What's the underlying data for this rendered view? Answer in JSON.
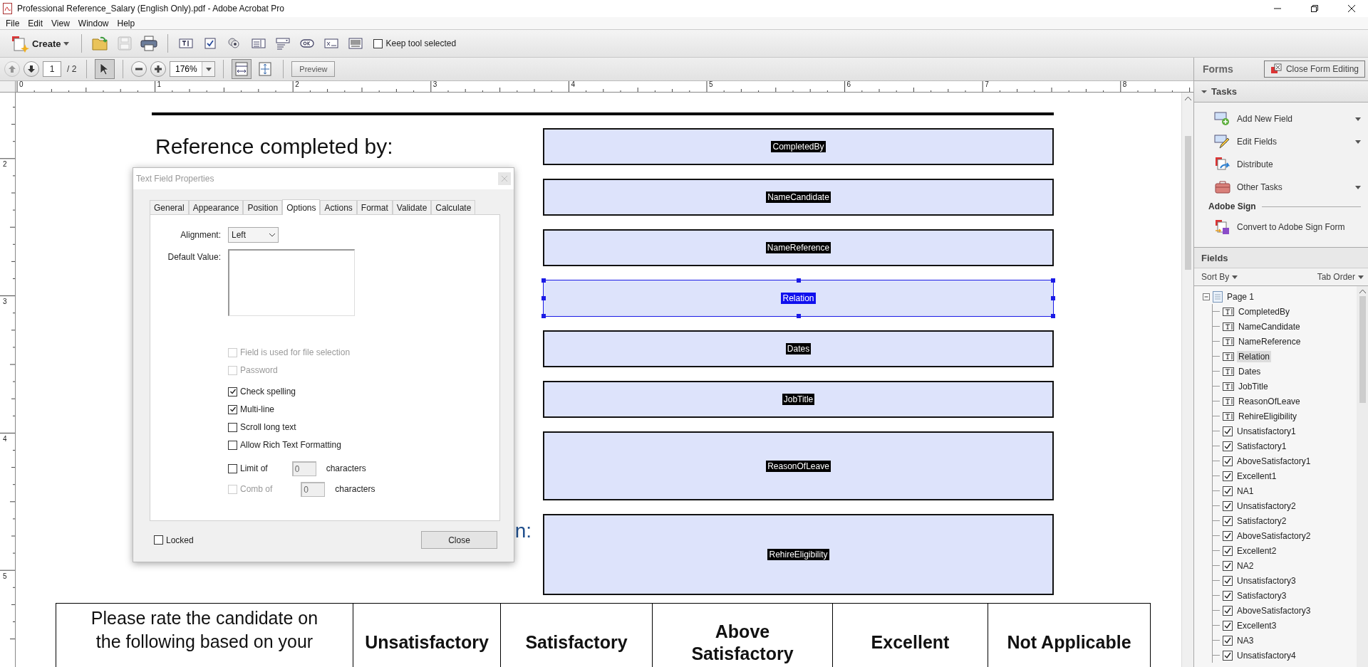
{
  "window": {
    "title": "Professional Reference_Salary (English Only).pdf - Adobe Acrobat Pro"
  },
  "menu": [
    "File",
    "Edit",
    "View",
    "Window",
    "Help"
  ],
  "toolbar": {
    "create": "Create",
    "keep_tool_selected": {
      "label": "Keep tool selected",
      "checked": false
    }
  },
  "nav": {
    "page": "1",
    "page_count": "/ 2",
    "zoom": "176%",
    "preview": "Preview"
  },
  "ruler": {
    "horizontal": [
      "0",
      "1",
      "2",
      "3",
      "4",
      "5",
      "6",
      "7",
      "8"
    ],
    "vertical": [
      "2",
      "3",
      "4",
      "5"
    ]
  },
  "document": {
    "fields": [
      {
        "name": "CompletedBy",
        "selected": false,
        "label": {
          "text": "Reference completed by:",
          "kind": "heading"
        }
      },
      {
        "name": "NameCandidate",
        "selected": false
      },
      {
        "name": "NameReference",
        "selected": false
      },
      {
        "name": "Relation",
        "selected": true
      },
      {
        "name": "Dates",
        "selected": false
      },
      {
        "name": "JobTitle",
        "selected": false
      },
      {
        "name": "ReasonOfLeave",
        "selected": false,
        "kind": "tall"
      },
      {
        "name": "RehireEligibility",
        "selected": false,
        "kind": "taller",
        "label": {
          "text": "n:",
          "kind": "section"
        }
      }
    ],
    "rating_table": {
      "prompt": "Please rate the candidate on the following based on your",
      "columns": [
        "Unsatisfactory",
        "Satisfactory",
        "Above Satisfactory",
        "Excellent",
        "Not Applicable"
      ]
    }
  },
  "dialog": {
    "title": "Text Field Properties",
    "tabs": [
      {
        "label": "General",
        "selected": false
      },
      {
        "label": "Appearance",
        "selected": false
      },
      {
        "label": "Position",
        "selected": false
      },
      {
        "label": "Options",
        "selected": true
      },
      {
        "label": "Actions",
        "selected": false
      },
      {
        "label": "Format",
        "selected": false
      },
      {
        "label": "Validate",
        "selected": false
      },
      {
        "label": "Calculate",
        "selected": false
      }
    ],
    "alignment": {
      "label": "Alignment:",
      "value": "Left"
    },
    "default_value": {
      "label": "Default Value:"
    },
    "options": [
      {
        "kind": "checkbox",
        "label": "Field is used for file selection",
        "checked": false,
        "disabled": true
      },
      {
        "kind": "checkbox",
        "label": "Password",
        "checked": false,
        "disabled": true
      },
      {
        "kind": "checkbox",
        "label": "Check spelling",
        "checked": true,
        "disabled": false
      },
      {
        "kind": "checkbox",
        "label": "Multi-line",
        "checked": true,
        "disabled": false
      },
      {
        "kind": "checkbox",
        "label": "Scroll long text",
        "checked": false,
        "disabled": false
      },
      {
        "kind": "checkbox",
        "label": "Allow Rich Text Formatting",
        "checked": false,
        "disabled": false
      },
      {
        "kind": "count",
        "label": "Limit of",
        "checked": false,
        "disabled": false,
        "value": "0",
        "suffix": "characters"
      },
      {
        "kind": "count",
        "label": "Comb of",
        "checked": false,
        "disabled": true,
        "value": "0",
        "suffix": "characters"
      }
    ],
    "locked": {
      "label": "Locked",
      "checked": false
    },
    "close": "Close"
  },
  "panel": {
    "title": "Forms",
    "close_button": "Close Form Editing",
    "tasks": {
      "title": "Tasks",
      "expanded": true,
      "items": [
        {
          "label": "Add New Field",
          "menu": true
        },
        {
          "label": "Edit Fields",
          "menu": true
        },
        {
          "label": "Distribute",
          "menu": false
        },
        {
          "label": "Other Tasks",
          "menu": true
        }
      ]
    },
    "adobe_sign": {
      "title": "Adobe Sign",
      "items": [
        {
          "label": "Convert to Adobe Sign Form"
        }
      ]
    },
    "fields": {
      "title": "Fields",
      "sort_by": "Sort By",
      "order": "Tab Order",
      "tree": [
        {
          "label": "Page 1",
          "expanded": true,
          "selected": false,
          "children": [
            {
              "label": "CompletedBy",
              "kind": "text",
              "selected": false
            },
            {
              "label": "NameCandidate",
              "kind": "text",
              "selected": false
            },
            {
              "label": "NameReference",
              "kind": "text",
              "selected": false
            },
            {
              "label": "Relation",
              "kind": "text",
              "selected": true
            },
            {
              "label": "Dates",
              "kind": "text",
              "selected": false
            },
            {
              "label": "JobTitle",
              "kind": "text",
              "selected": false
            },
            {
              "label": "ReasonOfLeave",
              "kind": "text",
              "selected": false
            },
            {
              "label": "RehireEligibility",
              "kind": "text",
              "selected": false
            },
            {
              "label": "Unsatisfactory1",
              "kind": "checkbox",
              "selected": false
            },
            {
              "label": "Satisfactory1",
              "kind": "checkbox",
              "selected": false
            },
            {
              "label": "AboveSatisfactory1",
              "kind": "checkbox",
              "selected": false
            },
            {
              "label": "Excellent1",
              "kind": "checkbox",
              "selected": false
            },
            {
              "label": "NA1",
              "kind": "checkbox",
              "selected": false
            },
            {
              "label": "Unsatisfactory2",
              "kind": "checkbox",
              "selected": false
            },
            {
              "label": "Satisfactory2",
              "kind": "checkbox",
              "selected": false
            },
            {
              "label": "AboveSatisfactory2",
              "kind": "checkbox",
              "selected": false
            },
            {
              "label": "Excellent2",
              "kind": "checkbox",
              "selected": false
            },
            {
              "label": "NA2",
              "kind": "checkbox",
              "selected": false
            },
            {
              "label": "Unsatisfactory3",
              "kind": "checkbox",
              "selected": false
            },
            {
              "label": "Satisfactory3",
              "kind": "checkbox",
              "selected": false
            },
            {
              "label": "AboveSatisfactory3",
              "kind": "checkbox",
              "selected": false
            },
            {
              "label": "Excellent3",
              "kind": "checkbox",
              "selected": false
            },
            {
              "label": "NA3",
              "kind": "checkbox",
              "selected": false
            },
            {
              "label": "Unsatisfactory4",
              "kind": "checkbox",
              "selected": false
            }
          ]
        }
      ]
    }
  }
}
